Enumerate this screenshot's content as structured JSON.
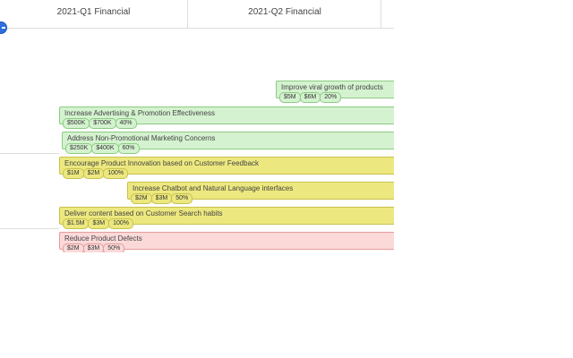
{
  "columns": [
    "2021-Q1 Financial",
    "2021-Q2 Financial"
  ],
  "initiatives": [
    {
      "title": "Improve viral growth of products",
      "chips": [
        "$5M",
        "$6M",
        "20%"
      ],
      "status": "green"
    },
    {
      "title": "Increase Advertising & Promotion Effectiveness",
      "chips": [
        "$500K",
        "$700K",
        "40%"
      ],
      "status": "green"
    },
    {
      "title": "Address Non-Promotional Marketing Concerns",
      "chips": [
        "$250K",
        "$400K",
        "60%"
      ],
      "status": "green"
    },
    {
      "title": "Encourage Product Innovation based on Customer Feedback",
      "chips": [
        "$1M",
        "$2M",
        "100%"
      ],
      "status": "yellow"
    },
    {
      "title": "Increase Chatbot and Natural Language interfaces",
      "chips": [
        "$2M",
        "$3M",
        "50%"
      ],
      "status": "yellow"
    },
    {
      "title": "Deliver content based on Customer Search habits",
      "chips": [
        "$1.5M",
        "$3M",
        "100%"
      ],
      "status": "yellow"
    },
    {
      "title": "Reduce Product Defects",
      "chips": [
        "$2M",
        "$3M",
        "50%"
      ],
      "status": "red"
    }
  ]
}
